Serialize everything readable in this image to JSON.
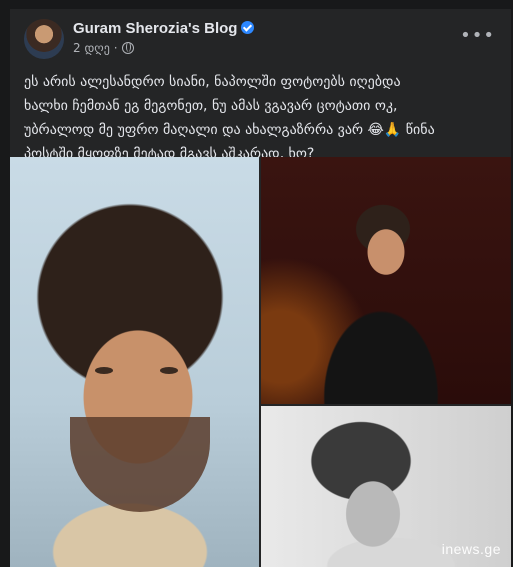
{
  "post": {
    "author": "Guram Sherozia's Blog",
    "time": "2 დღე",
    "dot": "·",
    "text": "ეს არის ალესანდრო სიანი, ნაპოლში ფოტოებს იღებდა\nხალხი ჩემთან ეგ მეგონეთ, ნუ ამას ვგავარ ცოტათი ოკ,\nუბრალოდ მე უფრო მაღალი და ახალგაზრრა ვარ 😂🙏 წინა\nპოსტში მყოფზე მეტად მგავს აშკარად, ხო?",
    "more": "•••"
  },
  "watermark": "inews.ge",
  "icons": {
    "verified": "verified-badge-icon",
    "privacy": "globe-icon",
    "menu": "more-options-icon"
  },
  "colors": {
    "background": "#18191a",
    "card": "#242526",
    "text": "#e4e6eb",
    "secondary": "#b0b3b8",
    "verified": "#2d88ff"
  }
}
